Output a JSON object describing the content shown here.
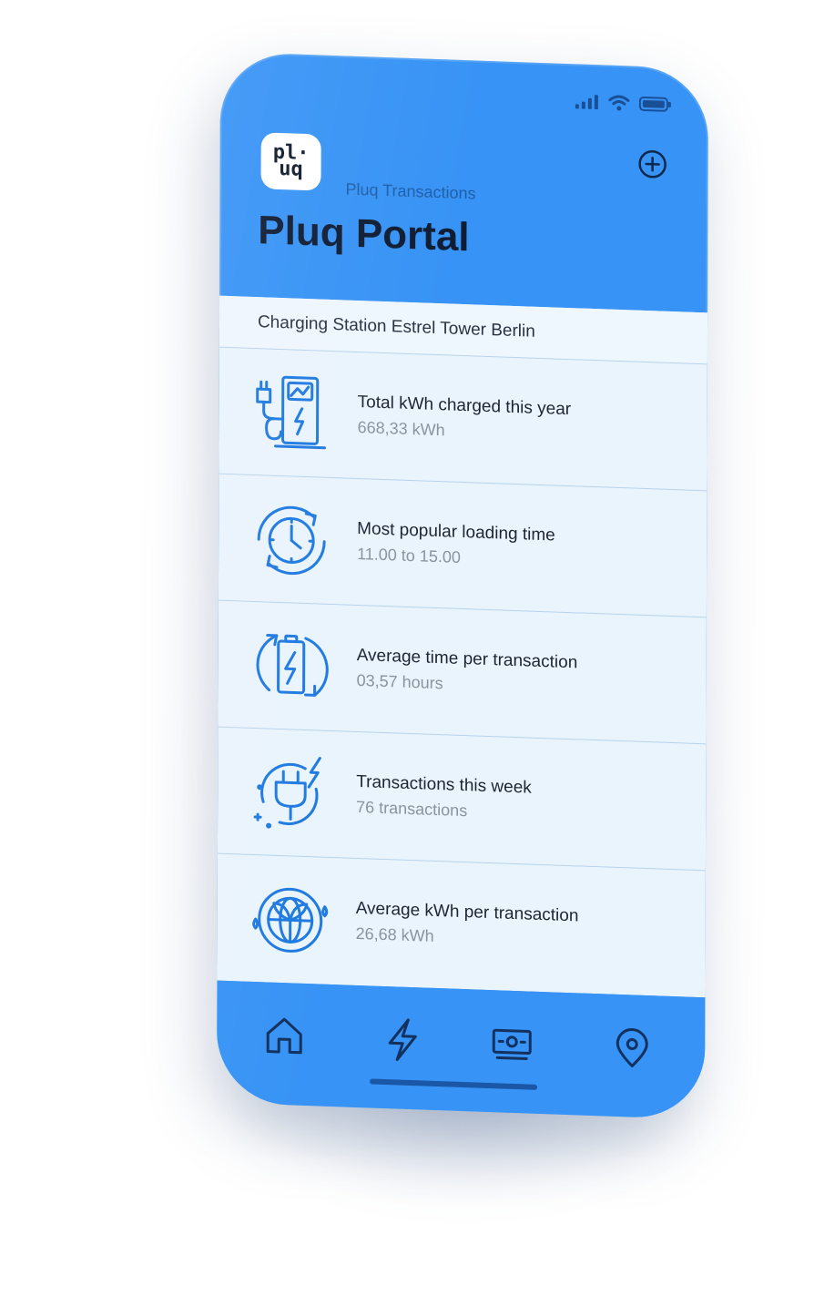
{
  "header": {
    "subtitle": "Pluq Transactions",
    "title": "Pluq Portal",
    "logo_text": "pl·\nuq"
  },
  "station": {
    "name": "Charging Station Estrel Tower Berlin"
  },
  "stats": [
    {
      "label": "Total kWh charged this year",
      "value": "668,33 kWh",
      "icon": "charging-station-icon"
    },
    {
      "label": "Most popular loading time",
      "value": "11.00 to 15.00",
      "icon": "clock-cycle-icon"
    },
    {
      "label": "Average time per transaction",
      "value": "03,57 hours",
      "icon": "battery-cycle-icon"
    },
    {
      "label": "Transactions this week",
      "value": "76 transactions",
      "icon": "plug-icon"
    },
    {
      "label": "Average kWh per transaction",
      "value": "26,68 kWh",
      "icon": "eco-globe-icon"
    }
  ],
  "tabs": [
    {
      "name": "home",
      "icon": "home-icon"
    },
    {
      "name": "charging",
      "icon": "lightning-icon"
    },
    {
      "name": "payments",
      "icon": "money-icon"
    },
    {
      "name": "locations",
      "icon": "location-pin-icon"
    }
  ],
  "colors": {
    "phone_blue": "#3793f5",
    "icon_blue": "#1f7ae0",
    "content_bg": "#eaf4fd",
    "title_dark": "#0f1c33"
  }
}
